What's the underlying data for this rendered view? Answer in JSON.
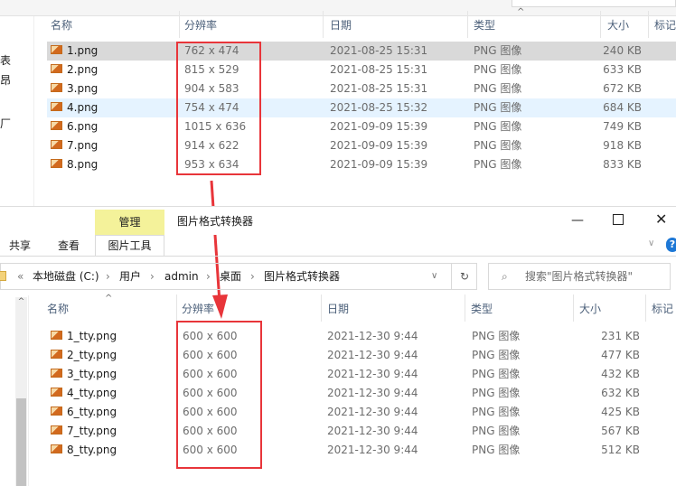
{
  "top_window": {
    "left_nav_fragments": [
      "表",
      "昂",
      "厂"
    ],
    "columns": [
      "名称",
      "分辨率",
      "日期",
      "类型",
      "大小",
      "标记"
    ],
    "files": [
      {
        "name": "1.png",
        "resolution": "762 x 474",
        "date": "2021-08-25 15:31",
        "type": "PNG 图像",
        "size": "240 KB",
        "state": "selected"
      },
      {
        "name": "2.png",
        "resolution": "815 x 529",
        "date": "2021-08-25 15:31",
        "type": "PNG 图像",
        "size": "633 KB",
        "state": ""
      },
      {
        "name": "3.png",
        "resolution": "904 x 583",
        "date": "2021-08-25 15:31",
        "type": "PNG 图像",
        "size": "672 KB",
        "state": ""
      },
      {
        "name": "4.png",
        "resolution": "754 x 474",
        "date": "2021-08-25 15:32",
        "type": "PNG 图像",
        "size": "684 KB",
        "state": "hover"
      },
      {
        "name": "6.png",
        "resolution": "1015 x 636",
        "date": "2021-09-09 15:39",
        "type": "PNG 图像",
        "size": "749 KB",
        "state": ""
      },
      {
        "name": "7.png",
        "resolution": "914 x 622",
        "date": "2021-09-09 15:39",
        "type": "PNG 图像",
        "size": "918 KB",
        "state": ""
      },
      {
        "name": "8.png",
        "resolution": "953 x 634",
        "date": "2021-09-09 15:39",
        "type": "PNG 图像",
        "size": "833 KB",
        "state": ""
      }
    ]
  },
  "bottom_window": {
    "title": "图片格式转换器",
    "context_tab": "管理",
    "ribbon_tabs": [
      "共享",
      "查看",
      "图片工具"
    ],
    "breadcrumb": [
      "«",
      "本地磁盘 (C:)",
      "用户",
      "admin",
      "桌面",
      "图片格式转换器"
    ],
    "search_placeholder": "搜索\"图片格式转换器\"",
    "columns": [
      "名称",
      "分辨率",
      "日期",
      "类型",
      "大小",
      "标记"
    ],
    "files": [
      {
        "name": "1_tty.png",
        "resolution": "600 x 600",
        "date": "2021-12-30 9:44",
        "type": "PNG 图像",
        "size": "231 KB"
      },
      {
        "name": "2_tty.png",
        "resolution": "600 x 600",
        "date": "2021-12-30 9:44",
        "type": "PNG 图像",
        "size": "477 KB"
      },
      {
        "name": "3_tty.png",
        "resolution": "600 x 600",
        "date": "2021-12-30 9:44",
        "type": "PNG 图像",
        "size": "432 KB"
      },
      {
        "name": "4_tty.png",
        "resolution": "600 x 600",
        "date": "2021-12-30 9:44",
        "type": "PNG 图像",
        "size": "632 KB"
      },
      {
        "name": "6_tty.png",
        "resolution": "600 x 600",
        "date": "2021-12-30 9:44",
        "type": "PNG 图像",
        "size": "425 KB"
      },
      {
        "name": "7_tty.png",
        "resolution": "600 x 600",
        "date": "2021-12-30 9:44",
        "type": "PNG 图像",
        "size": "567 KB"
      },
      {
        "name": "8_tty.png",
        "resolution": "600 x 600",
        "date": "2021-12-30 9:44",
        "type": "PNG 图像",
        "size": "512 KB"
      }
    ]
  },
  "colors": {
    "annotation": "#e8353a",
    "selected_row": "#d9d9d9",
    "hover_row": "#e5f3ff",
    "manage_tab": "#f4f29a"
  }
}
